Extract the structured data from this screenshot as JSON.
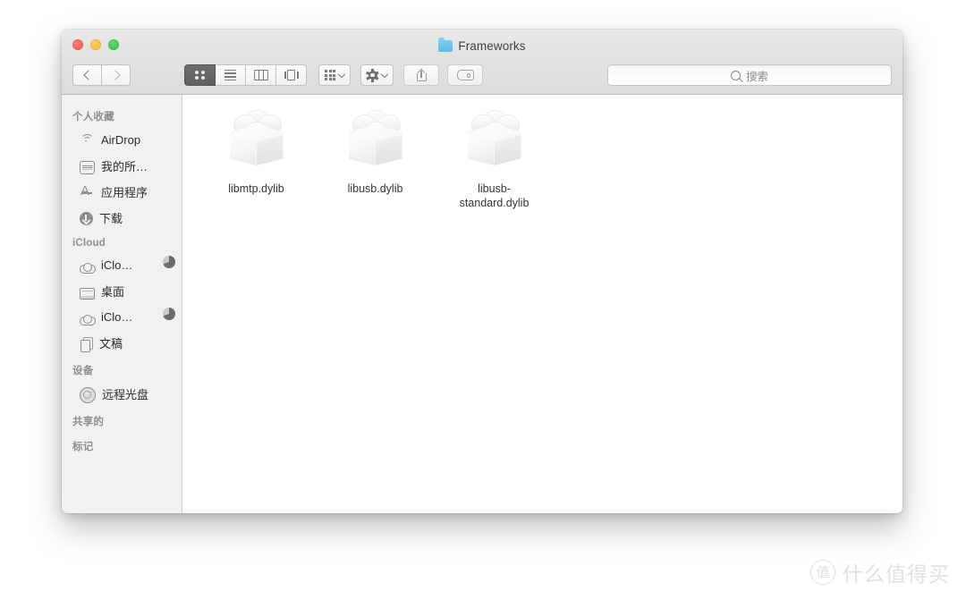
{
  "window": {
    "title": "Frameworks",
    "title_icon": "blue-folder-icon",
    "traffic_lights": {
      "close": "close-button",
      "minimize": "minimize-button",
      "maximize": "maximize-button",
      "close_color": "#f4554a",
      "minimize_color": "#f7b52b",
      "maximize_color": "#28c03d"
    }
  },
  "toolbar": {
    "back_icon": "chevron-left-icon",
    "forward_icon": "chevron-right-icon",
    "view_modes": [
      {
        "name": "icon-view",
        "icon": "grid-dots-icon",
        "selected": true
      },
      {
        "name": "list-view",
        "icon": "list-lines-icon",
        "selected": false
      },
      {
        "name": "column-view",
        "icon": "columns-icon",
        "selected": false
      },
      {
        "name": "gallery-view",
        "icon": "gallery-icon",
        "selected": false
      }
    ],
    "arrange_icon": "arrange-grid-icon",
    "action_icon": "gear-icon",
    "share_icon": "share-icon",
    "tag_icon": "tag-icon",
    "dropdown_icon": "chevron-down-icon"
  },
  "search": {
    "icon": "search-icon",
    "placeholder": "搜索",
    "value": ""
  },
  "sidebar": {
    "sections": [
      {
        "header": "个人收藏",
        "items": [
          {
            "label": "AirDrop",
            "icon": "airdrop-icon",
            "badge": null
          },
          {
            "label": "我的所…",
            "icon": "disk-icon",
            "badge": null
          },
          {
            "label": "应用程序",
            "icon": "applications-icon",
            "badge": null
          },
          {
            "label": "下载",
            "icon": "downloads-icon",
            "badge": null
          }
        ]
      },
      {
        "header": "iCloud",
        "items": [
          {
            "label": "iClo…",
            "icon": "cloud-icon",
            "badge": "progress-pie"
          },
          {
            "label": "桌面",
            "icon": "desktop-icon",
            "badge": null
          },
          {
            "label": "iClo…",
            "icon": "cloud-icon",
            "badge": "progress-pie"
          },
          {
            "label": "文稿",
            "icon": "documents-icon",
            "badge": null
          }
        ]
      },
      {
        "header": "设备",
        "items": [
          {
            "label": "远程光盘",
            "icon": "disc-icon",
            "badge": null
          }
        ]
      },
      {
        "header": "共享的",
        "items": []
      },
      {
        "header": "标记",
        "items": []
      }
    ]
  },
  "content": {
    "files": [
      {
        "name": "libmtp.dylib",
        "icon": "dylib-brick-icon"
      },
      {
        "name": "libusb.dylib",
        "icon": "dylib-brick-icon"
      },
      {
        "name": "libusb-standard.dylib",
        "icon": "dylib-brick-icon"
      }
    ]
  },
  "watermark": {
    "badge": "值",
    "text": "什么值得买"
  }
}
